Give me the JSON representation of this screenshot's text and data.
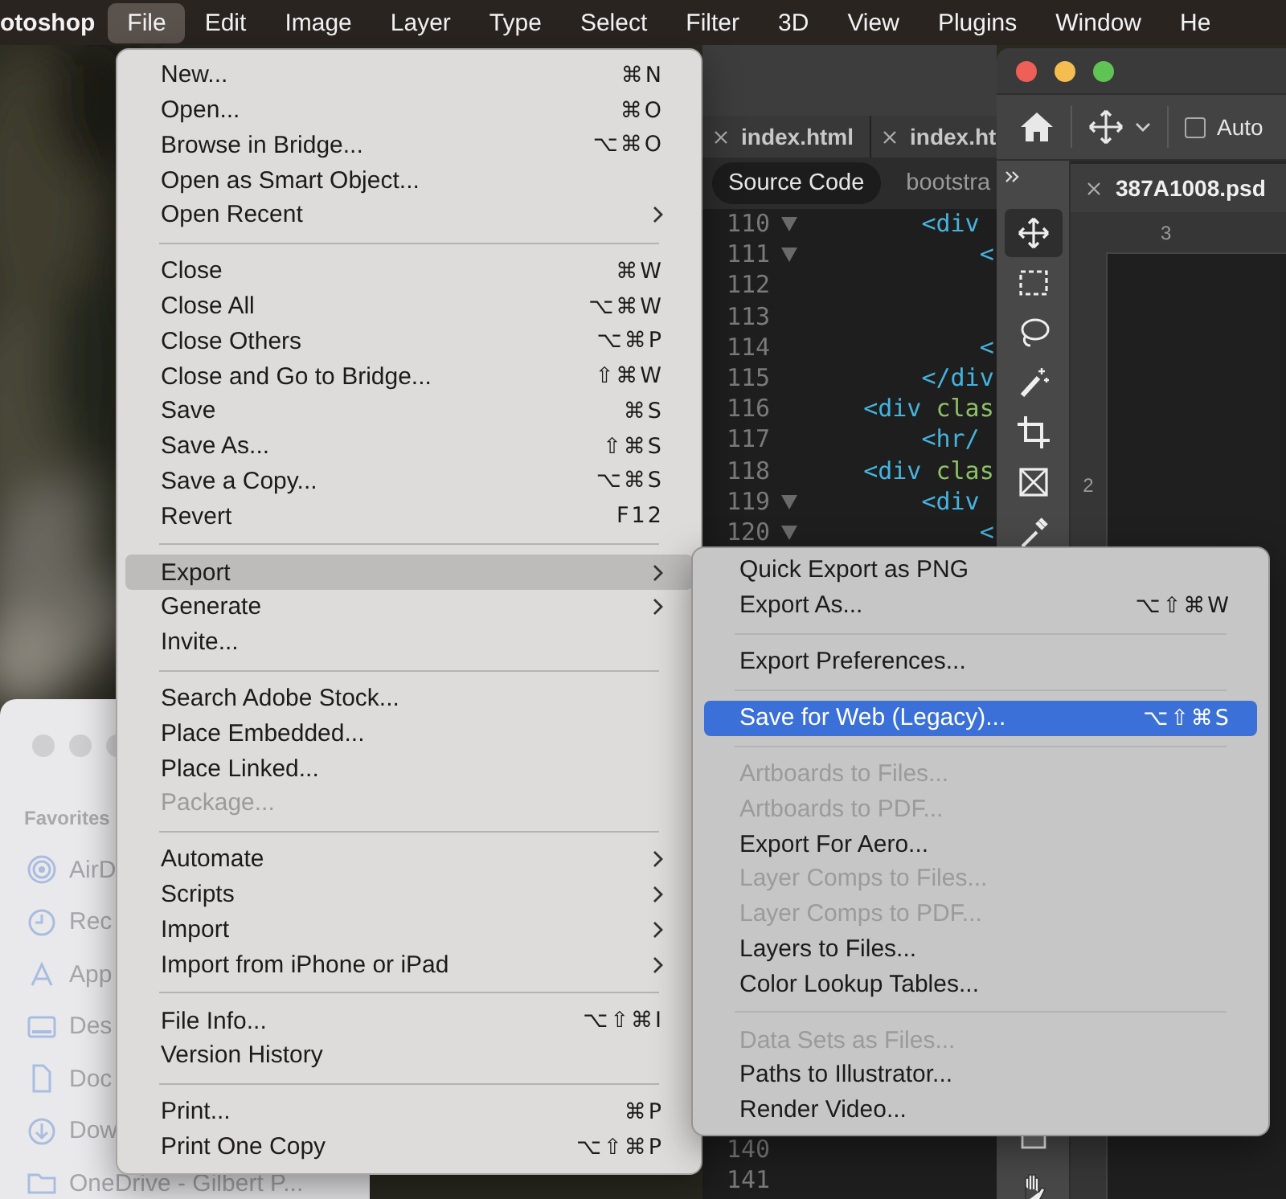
{
  "menu_bar": {
    "app_name": "otoshop",
    "items": [
      {
        "label": "File",
        "selected": true
      },
      {
        "label": "Edit",
        "selected": false
      },
      {
        "label": "Image",
        "selected": false
      },
      {
        "label": "Layer",
        "selected": false
      },
      {
        "label": "Type",
        "selected": false
      },
      {
        "label": "Select",
        "selected": false
      },
      {
        "label": "Filter",
        "selected": false
      },
      {
        "label": "3D",
        "selected": false
      },
      {
        "label": "View",
        "selected": false
      },
      {
        "label": "Plugins",
        "selected": false
      },
      {
        "label": "Window",
        "selected": false
      },
      {
        "label": "He",
        "selected": false
      }
    ]
  },
  "file_menu": {
    "items": [
      {
        "kind": "item",
        "label": "New...",
        "shortcut": "⌘N",
        "submenu": false,
        "disabled": false,
        "selected": false
      },
      {
        "kind": "item",
        "label": "Open...",
        "shortcut": "⌘O",
        "submenu": false,
        "disabled": false,
        "selected": false
      },
      {
        "kind": "item",
        "label": "Browse in Bridge...",
        "shortcut": "⌥⌘O",
        "submenu": false,
        "disabled": false,
        "selected": false
      },
      {
        "kind": "item",
        "label": "Open as Smart Object...",
        "submenu": false,
        "disabled": false,
        "selected": false
      },
      {
        "kind": "item",
        "label": "Open Recent",
        "submenu": true,
        "disabled": false,
        "selected": false
      },
      {
        "kind": "separator"
      },
      {
        "kind": "item",
        "label": "Close",
        "shortcut": "⌘W",
        "submenu": false,
        "disabled": false,
        "selected": false
      },
      {
        "kind": "item",
        "label": "Close All",
        "shortcut": "⌥⌘W",
        "submenu": false,
        "disabled": false,
        "selected": false
      },
      {
        "kind": "item",
        "label": "Close Others",
        "shortcut": "⌥⌘P",
        "submenu": false,
        "disabled": false,
        "selected": false
      },
      {
        "kind": "item",
        "label": "Close and Go to Bridge...",
        "shortcut": "⇧⌘W",
        "submenu": false,
        "disabled": false,
        "selected": false
      },
      {
        "kind": "item",
        "label": "Save",
        "shortcut": "⌘S",
        "submenu": false,
        "disabled": false,
        "selected": false
      },
      {
        "kind": "item",
        "label": "Save As...",
        "shortcut": "⇧⌘S",
        "submenu": false,
        "disabled": false,
        "selected": false
      },
      {
        "kind": "item",
        "label": "Save a Copy...",
        "shortcut": "⌥⌘S",
        "submenu": false,
        "disabled": false,
        "selected": false
      },
      {
        "kind": "item",
        "label": "Revert",
        "shortcut": "F12",
        "submenu": false,
        "disabled": false,
        "selected": false
      },
      {
        "kind": "separator"
      },
      {
        "kind": "item",
        "label": "Export",
        "submenu": true,
        "disabled": false,
        "selected": true
      },
      {
        "kind": "item",
        "label": "Generate",
        "submenu": true,
        "disabled": false,
        "selected": false
      },
      {
        "kind": "item",
        "label": "Invite...",
        "submenu": false,
        "disabled": false,
        "selected": false
      },
      {
        "kind": "separator"
      },
      {
        "kind": "item",
        "label": "Search Adobe Stock...",
        "submenu": false,
        "disabled": false,
        "selected": false
      },
      {
        "kind": "item",
        "label": "Place Embedded...",
        "submenu": false,
        "disabled": false,
        "selected": false
      },
      {
        "kind": "item",
        "label": "Place Linked...",
        "submenu": false,
        "disabled": false,
        "selected": false
      },
      {
        "kind": "item",
        "label": "Package...",
        "submenu": false,
        "disabled": true,
        "selected": false
      },
      {
        "kind": "separator"
      },
      {
        "kind": "item",
        "label": "Automate",
        "submenu": true,
        "disabled": false,
        "selected": false
      },
      {
        "kind": "item",
        "label": "Scripts",
        "submenu": true,
        "disabled": false,
        "selected": false
      },
      {
        "kind": "item",
        "label": "Import",
        "submenu": true,
        "disabled": false,
        "selected": false
      },
      {
        "kind": "item",
        "label": "Import from iPhone or iPad",
        "submenu": true,
        "disabled": false,
        "selected": false
      },
      {
        "kind": "separator"
      },
      {
        "kind": "item",
        "label": "File Info...",
        "shortcut": "⌥⇧⌘I",
        "submenu": false,
        "disabled": false,
        "selected": false
      },
      {
        "kind": "item",
        "label": "Version History",
        "submenu": false,
        "disabled": false,
        "selected": false
      },
      {
        "kind": "separator"
      },
      {
        "kind": "item",
        "label": "Print...",
        "shortcut": "⌘P",
        "submenu": false,
        "disabled": false,
        "selected": false
      },
      {
        "kind": "item",
        "label": "Print One Copy",
        "shortcut": "⌥⇧⌘P",
        "submenu": false,
        "disabled": false,
        "selected": false
      }
    ]
  },
  "export_submenu": {
    "items": [
      {
        "kind": "item",
        "label": "Quick Export as PNG",
        "disabled": false,
        "selected": false
      },
      {
        "kind": "item",
        "label": "Export As...",
        "shortcut": "⌥⇧⌘W",
        "disabled": false,
        "selected": false
      },
      {
        "kind": "separator"
      },
      {
        "kind": "item",
        "label": "Export Preferences...",
        "disabled": false,
        "selected": false
      },
      {
        "kind": "separator"
      },
      {
        "kind": "item",
        "label": "Save for Web (Legacy)...",
        "shortcut": "⌥⇧⌘S",
        "disabled": false,
        "selected": true
      },
      {
        "kind": "separator"
      },
      {
        "kind": "item",
        "label": "Artboards to Files...",
        "disabled": true,
        "selected": false
      },
      {
        "kind": "item",
        "label": "Artboards to PDF...",
        "disabled": true,
        "selected": false
      },
      {
        "kind": "item",
        "label": "Export For Aero...",
        "disabled": false,
        "selected": false
      },
      {
        "kind": "item",
        "label": "Layer Comps to Files...",
        "disabled": true,
        "selected": false
      },
      {
        "kind": "item",
        "label": "Layer Comps to PDF...",
        "disabled": true,
        "selected": false
      },
      {
        "kind": "item",
        "label": "Layers to Files...",
        "disabled": false,
        "selected": false
      },
      {
        "kind": "item",
        "label": "Color Lookup Tables...",
        "disabled": false,
        "selected": false
      },
      {
        "kind": "separator"
      },
      {
        "kind": "item",
        "label": "Data Sets as Files...",
        "disabled": true,
        "selected": false
      },
      {
        "kind": "item",
        "label": "Paths to Illustrator...",
        "disabled": false,
        "selected": false
      },
      {
        "kind": "item",
        "label": "Render Video...",
        "disabled": false,
        "selected": false
      }
    ]
  },
  "code_editor": {
    "tabs": [
      {
        "label": "index.html"
      },
      {
        "label": "index.ht"
      }
    ],
    "view_buttons": [
      {
        "label": "Source Code",
        "selected": true
      },
      {
        "label": "bootstra",
        "selected": false
      }
    ],
    "lines": [
      {
        "number": "110",
        "fold": true,
        "code": [
          {
            "kind": "tag",
            "text": "       <div"
          }
        ]
      },
      {
        "number": "111",
        "fold": true,
        "code": [
          {
            "kind": "tag",
            "text": "           <"
          }
        ]
      },
      {
        "number": "112",
        "fold": false
      },
      {
        "number": "113",
        "fold": false
      },
      {
        "number": "114",
        "fold": false,
        "code": [
          {
            "kind": "tag",
            "text": "           <"
          }
        ]
      },
      {
        "number": "115",
        "fold": false,
        "code": [
          {
            "kind": "tag",
            "text": "       </div"
          }
        ]
      },
      {
        "number": "116",
        "fold": false,
        "code": [
          {
            "kind": "tag",
            "text": "   <div"
          },
          {
            "kind": "attr",
            "text": " clas"
          }
        ]
      },
      {
        "number": "117",
        "fold": false,
        "code": [
          {
            "kind": "tag",
            "text": "       <hr/"
          }
        ]
      },
      {
        "number": "118",
        "fold": false,
        "code": [
          {
            "kind": "tag",
            "text": "   <div"
          },
          {
            "kind": "attr",
            "text": " clas"
          }
        ]
      },
      {
        "number": "119",
        "fold": true,
        "code": [
          {
            "kind": "tag",
            "text": "       <div"
          }
        ]
      },
      {
        "number": "120",
        "fold": true,
        "code": [
          {
            "kind": "tag",
            "text": "           <"
          }
        ]
      }
    ],
    "bottom_lines": [
      {
        "number": "140"
      },
      {
        "number": "141"
      }
    ]
  },
  "photoshop": {
    "auto_select": {
      "label": "Auto",
      "checked": false
    },
    "document_tab": {
      "label": "387A1008.psd"
    },
    "ruler": {
      "top_mark": "3",
      "left_mark": "2"
    },
    "tools": [
      {
        "kind": "move",
        "selected": true
      },
      {
        "kind": "marquee",
        "selected": false
      },
      {
        "kind": "lasso",
        "selected": false
      },
      {
        "kind": "wand",
        "selected": false
      },
      {
        "kind": "crop",
        "selected": false
      },
      {
        "kind": "frame",
        "selected": false
      },
      {
        "kind": "eyedropper",
        "selected": false
      }
    ],
    "bottom_tools": [
      {
        "kind": "rectangle",
        "selected": false
      },
      {
        "kind": "hand",
        "selected": false
      }
    ]
  },
  "finder": {
    "heading": "Favorites",
    "items": [
      {
        "kind": "airdrop",
        "label": "AirD"
      },
      {
        "kind": "recents",
        "label": "Rec"
      },
      {
        "kind": "applications",
        "label": "App"
      },
      {
        "kind": "desktop",
        "label": "Des"
      },
      {
        "kind": "documents",
        "label": "Doc"
      },
      {
        "kind": "downloads",
        "label": "Dow"
      },
      {
        "kind": "folder",
        "label": "OneDrive - Gilbert P..."
      }
    ]
  }
}
